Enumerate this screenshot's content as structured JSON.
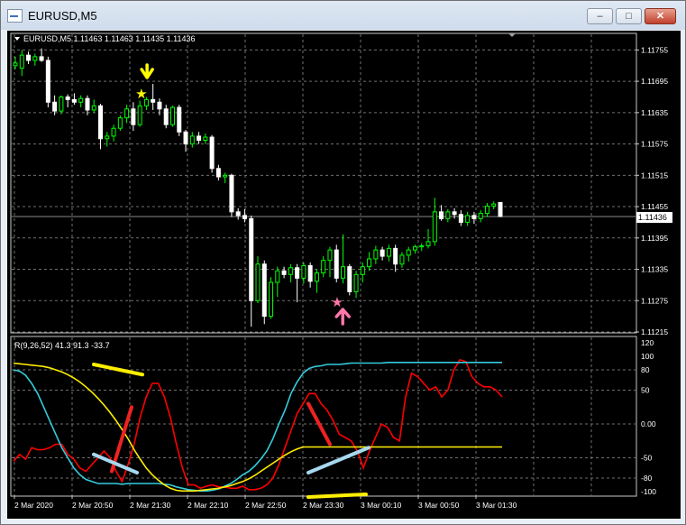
{
  "window": {
    "title": "EURUSD,M5",
    "minimize": "–",
    "maximize": "□",
    "close": "✕"
  },
  "main_chart": {
    "header": "EURUSD,M5  1.11463 1.11463 1.11435 1.11436",
    "current_price": "1.11436",
    "price_labels": [
      "1.11755",
      "1.11695",
      "1.11635",
      "1.11575",
      "1.11515",
      "1.11455",
      "1.11395",
      "1.11335",
      "1.11275",
      "1.11215"
    ],
    "up_color": "#00ff00",
    "down_color": "#ffffff"
  },
  "indicator": {
    "header": "R(9,26,52) 41.3 91.3 -33.7",
    "scale_labels": [
      "120",
      "100",
      "80",
      "50",
      "0.00",
      "-50",
      "-80",
      "-100"
    ]
  },
  "time_axis": [
    "2 Mar 2020",
    "2 Mar 20:50",
    "2 Mar 21:30",
    "2 Mar 22:10",
    "2 Mar 22:50",
    "2 Mar 23:30",
    "3 Mar 00:10",
    "3 Mar 00:50",
    "3 Mar 01:30"
  ],
  "markers": {
    "sell_arrow_color": "#ffff00",
    "buy_arrow_color": "#ff77aa",
    "star": "★"
  },
  "chart_data": [
    {
      "type": "candlestick",
      "symbol": "EURUSD",
      "timeframe": "M5",
      "ylim": [
        1.11215,
        1.11785
      ],
      "candles": [
        {
          "o": 1.11725,
          "h": 1.11742,
          "l": 1.11718,
          "c": 1.1173
        },
        {
          "o": 1.1172,
          "h": 1.11755,
          "l": 1.11705,
          "c": 1.11745
        },
        {
          "o": 1.11745,
          "h": 1.11752,
          "l": 1.11728,
          "c": 1.11735
        },
        {
          "o": 1.11735,
          "h": 1.11748,
          "l": 1.11725,
          "c": 1.11742
        },
        {
          "o": 1.11742,
          "h": 1.11758,
          "l": 1.11732,
          "c": 1.11735
        },
        {
          "o": 1.11735,
          "h": 1.11742,
          "l": 1.11645,
          "c": 1.11655
        },
        {
          "o": 1.11655,
          "h": 1.11668,
          "l": 1.1163,
          "c": 1.11638
        },
        {
          "o": 1.11638,
          "h": 1.11668,
          "l": 1.11632,
          "c": 1.11665
        },
        {
          "o": 1.11665,
          "h": 1.1167,
          "l": 1.11645,
          "c": 1.1166
        },
        {
          "o": 1.1166,
          "h": 1.11672,
          "l": 1.1165,
          "c": 1.11655
        },
        {
          "o": 1.11655,
          "h": 1.11668,
          "l": 1.11645,
          "c": 1.11662
        },
        {
          "o": 1.11662,
          "h": 1.11668,
          "l": 1.1163,
          "c": 1.1164
        },
        {
          "o": 1.1164,
          "h": 1.1166,
          "l": 1.11635,
          "c": 1.11648
        },
        {
          "o": 1.11648,
          "h": 1.11652,
          "l": 1.11565,
          "c": 1.11585
        },
        {
          "o": 1.11585,
          "h": 1.11598,
          "l": 1.1157,
          "c": 1.1159
        },
        {
          "o": 1.1159,
          "h": 1.11612,
          "l": 1.1158,
          "c": 1.11605
        },
        {
          "o": 1.11605,
          "h": 1.1163,
          "l": 1.116,
          "c": 1.11625
        },
        {
          "o": 1.11625,
          "h": 1.1165,
          "l": 1.11615,
          "c": 1.11642
        },
        {
          "o": 1.11642,
          "h": 1.11655,
          "l": 1.116,
          "c": 1.11612
        },
        {
          "o": 1.11612,
          "h": 1.11658,
          "l": 1.11608,
          "c": 1.11648
        },
        {
          "o": 1.11648,
          "h": 1.11665,
          "l": 1.1164,
          "c": 1.1166
        },
        {
          "o": 1.1166,
          "h": 1.1169,
          "l": 1.1164,
          "c": 1.11655
        },
        {
          "o": 1.11655,
          "h": 1.11662,
          "l": 1.1163,
          "c": 1.11642
        },
        {
          "o": 1.11642,
          "h": 1.1165,
          "l": 1.11605,
          "c": 1.11612
        },
        {
          "o": 1.11612,
          "h": 1.11648,
          "l": 1.11608,
          "c": 1.11645
        },
        {
          "o": 1.11645,
          "h": 1.1165,
          "l": 1.1159,
          "c": 1.11598
        },
        {
          "o": 1.11598,
          "h": 1.11602,
          "l": 1.1156,
          "c": 1.11575
        },
        {
          "o": 1.11575,
          "h": 1.11598,
          "l": 1.11568,
          "c": 1.1159
        },
        {
          "o": 1.1159,
          "h": 1.11598,
          "l": 1.11575,
          "c": 1.11582
        },
        {
          "o": 1.11582,
          "h": 1.11595,
          "l": 1.11575,
          "c": 1.11588
        },
        {
          "o": 1.11588,
          "h": 1.11592,
          "l": 1.1152,
          "c": 1.11528
        },
        {
          "o": 1.11528,
          "h": 1.11535,
          "l": 1.11505,
          "c": 1.11512
        },
        {
          "o": 1.11512,
          "h": 1.1152,
          "l": 1.115,
          "c": 1.11515
        },
        {
          "o": 1.11515,
          "h": 1.11518,
          "l": 1.11435,
          "c": 1.11445
        },
        {
          "o": 1.11445,
          "h": 1.11452,
          "l": 1.1143,
          "c": 1.11438
        },
        {
          "o": 1.11438,
          "h": 1.1145,
          "l": 1.11425,
          "c": 1.11432
        },
        {
          "o": 1.11432,
          "h": 1.11438,
          "l": 1.11225,
          "c": 1.11275
        },
        {
          "o": 1.11275,
          "h": 1.1136,
          "l": 1.1127,
          "c": 1.11345
        },
        {
          "o": 1.11345,
          "h": 1.11352,
          "l": 1.1123,
          "c": 1.11245
        },
        {
          "o": 1.11245,
          "h": 1.1132,
          "l": 1.1124,
          "c": 1.1131
        },
        {
          "o": 1.1131,
          "h": 1.1134,
          "l": 1.11282,
          "c": 1.11332
        },
        {
          "o": 1.11332,
          "h": 1.1134,
          "l": 1.11318,
          "c": 1.11325
        },
        {
          "o": 1.11325,
          "h": 1.11345,
          "l": 1.1131,
          "c": 1.11338
        },
        {
          "o": 1.11338,
          "h": 1.11345,
          "l": 1.11272,
          "c": 1.11318
        },
        {
          "o": 1.11318,
          "h": 1.11348,
          "l": 1.11308,
          "c": 1.11342
        },
        {
          "o": 1.11342,
          "h": 1.11348,
          "l": 1.113,
          "c": 1.11312
        },
        {
          "o": 1.11312,
          "h": 1.11335,
          "l": 1.1129,
          "c": 1.11328
        },
        {
          "o": 1.11328,
          "h": 1.1136,
          "l": 1.1132,
          "c": 1.11352
        },
        {
          "o": 1.11352,
          "h": 1.11378,
          "l": 1.1132,
          "c": 1.11372
        },
        {
          "o": 1.11372,
          "h": 1.11382,
          "l": 1.1131,
          "c": 1.11318
        },
        {
          "o": 1.11318,
          "h": 1.11402,
          "l": 1.11308,
          "c": 1.1134
        },
        {
          "o": 1.1134,
          "h": 1.11345,
          "l": 1.11285,
          "c": 1.11292
        },
        {
          "o": 1.11292,
          "h": 1.11332,
          "l": 1.1128,
          "c": 1.11325
        },
        {
          "o": 1.11325,
          "h": 1.11348,
          "l": 1.1131,
          "c": 1.1134
        },
        {
          "o": 1.1134,
          "h": 1.11368,
          "l": 1.11332,
          "c": 1.11355
        },
        {
          "o": 1.11355,
          "h": 1.1138,
          "l": 1.11345,
          "c": 1.11372
        },
        {
          "o": 1.11372,
          "h": 1.11378,
          "l": 1.11352,
          "c": 1.1136
        },
        {
          "o": 1.1136,
          "h": 1.11382,
          "l": 1.1135,
          "c": 1.11375
        },
        {
          "o": 1.11375,
          "h": 1.11382,
          "l": 1.1133,
          "c": 1.11345
        },
        {
          "o": 1.11345,
          "h": 1.11368,
          "l": 1.11338,
          "c": 1.11362
        },
        {
          "o": 1.11362,
          "h": 1.11378,
          "l": 1.1135,
          "c": 1.11372
        },
        {
          "o": 1.11372,
          "h": 1.11382,
          "l": 1.11365,
          "c": 1.11378
        },
        {
          "o": 1.11378,
          "h": 1.11385,
          "l": 1.1137,
          "c": 1.1138
        },
        {
          "o": 1.1138,
          "h": 1.11412,
          "l": 1.11375,
          "c": 1.11388
        },
        {
          "o": 1.11388,
          "h": 1.11472,
          "l": 1.1138,
          "c": 1.11445
        },
        {
          "o": 1.11445,
          "h": 1.11458,
          "l": 1.11428,
          "c": 1.11432
        },
        {
          "o": 1.11432,
          "h": 1.1145,
          "l": 1.11425,
          "c": 1.11445
        },
        {
          "o": 1.11445,
          "h": 1.11452,
          "l": 1.11432,
          "c": 1.1144
        },
        {
          "o": 1.1144,
          "h": 1.11448,
          "l": 1.11418,
          "c": 1.11425
        },
        {
          "o": 1.11425,
          "h": 1.11445,
          "l": 1.11418,
          "c": 1.11438
        },
        {
          "o": 1.11438,
          "h": 1.11445,
          "l": 1.11422,
          "c": 1.11432
        },
        {
          "o": 1.11432,
          "h": 1.11448,
          "l": 1.11425,
          "c": 1.11442
        },
        {
          "o": 1.11442,
          "h": 1.11462,
          "l": 1.11435,
          "c": 1.11456
        },
        {
          "o": 1.11456,
          "h": 1.11465,
          "l": 1.1145,
          "c": 1.1146
        },
        {
          "o": 1.11463,
          "h": 1.11463,
          "l": 1.11435,
          "c": 1.11436
        }
      ]
    },
    {
      "type": "line",
      "indicator": "R(9,26,52)",
      "ylim": [
        -100,
        120
      ],
      "series": [
        {
          "name": "fast",
          "color": "#ff0000",
          "values": [
            -55,
            -45,
            -52,
            -35,
            -38,
            -38,
            -35,
            -30,
            -30,
            -45,
            -52,
            -65,
            -70,
            -60,
            -50,
            -40,
            -50,
            -70,
            -85,
            -60,
            -30,
            10,
            40,
            60,
            60,
            40,
            10,
            -30,
            -65,
            -90,
            -90,
            -95,
            -92,
            -90,
            -93,
            -93,
            -95,
            -95,
            -92,
            -97,
            -97,
            -95,
            -90,
            -80,
            -60,
            -35,
            -10,
            15,
            30,
            45,
            45,
            30,
            20,
            5,
            -15,
            -20,
            -25,
            -40,
            -65,
            -40,
            -20,
            0,
            -5,
            -20,
            -25,
            40,
            75,
            70,
            60,
            50,
            55,
            40,
            50,
            80,
            95,
            92,
            70,
            60,
            55,
            55,
            50,
            40
          ]
        },
        {
          "name": "middle",
          "color": "#33ccdd",
          "values": [
            80,
            78,
            72,
            60,
            45,
            25,
            5,
            -15,
            -35,
            -50,
            -65,
            -75,
            -82,
            -85,
            -88,
            -88,
            -88,
            -88,
            -89,
            -88,
            -88,
            -88,
            -88,
            -88,
            -88,
            -89,
            -90,
            -93,
            -95,
            -97,
            -98,
            -99,
            -99,
            -98,
            -96,
            -92,
            -88,
            -82,
            -75,
            -70,
            -62,
            -52,
            -40,
            -22,
            0,
            20,
            45,
            62,
            75,
            82,
            85,
            86,
            88,
            88,
            88,
            89,
            90,
            90,
            90,
            90,
            90,
            90,
            91,
            91,
            91,
            91,
            91,
            91,
            91,
            91,
            91,
            91,
            91,
            91,
            91,
            91,
            91,
            91,
            91,
            91,
            91,
            91
          ]
        },
        {
          "name": "slow",
          "color": "#ffee00",
          "values": [
            90,
            89,
            88,
            87,
            86,
            85,
            83,
            80,
            77,
            73,
            68,
            62,
            55,
            47,
            38,
            28,
            17,
            5,
            -8,
            -22,
            -38,
            -52,
            -65,
            -75,
            -83,
            -90,
            -95,
            -98,
            -99,
            -99,
            -99,
            -98,
            -97,
            -96,
            -95,
            -93,
            -91,
            -88,
            -85,
            -81,
            -76,
            -70,
            -64,
            -58,
            -52,
            -46,
            -41,
            -37,
            -34,
            -34,
            -34,
            -34,
            -34,
            -34,
            -34,
            -34,
            -34,
            -34,
            -34,
            -34,
            -34,
            -34,
            -34,
            -34,
            -34,
            -34,
            -34,
            -34,
            -34,
            -34,
            -34,
            -34,
            -34,
            -34,
            -34,
            -34,
            -34,
            -34,
            -34,
            -34,
            -34,
            -34
          ]
        }
      ]
    }
  ]
}
